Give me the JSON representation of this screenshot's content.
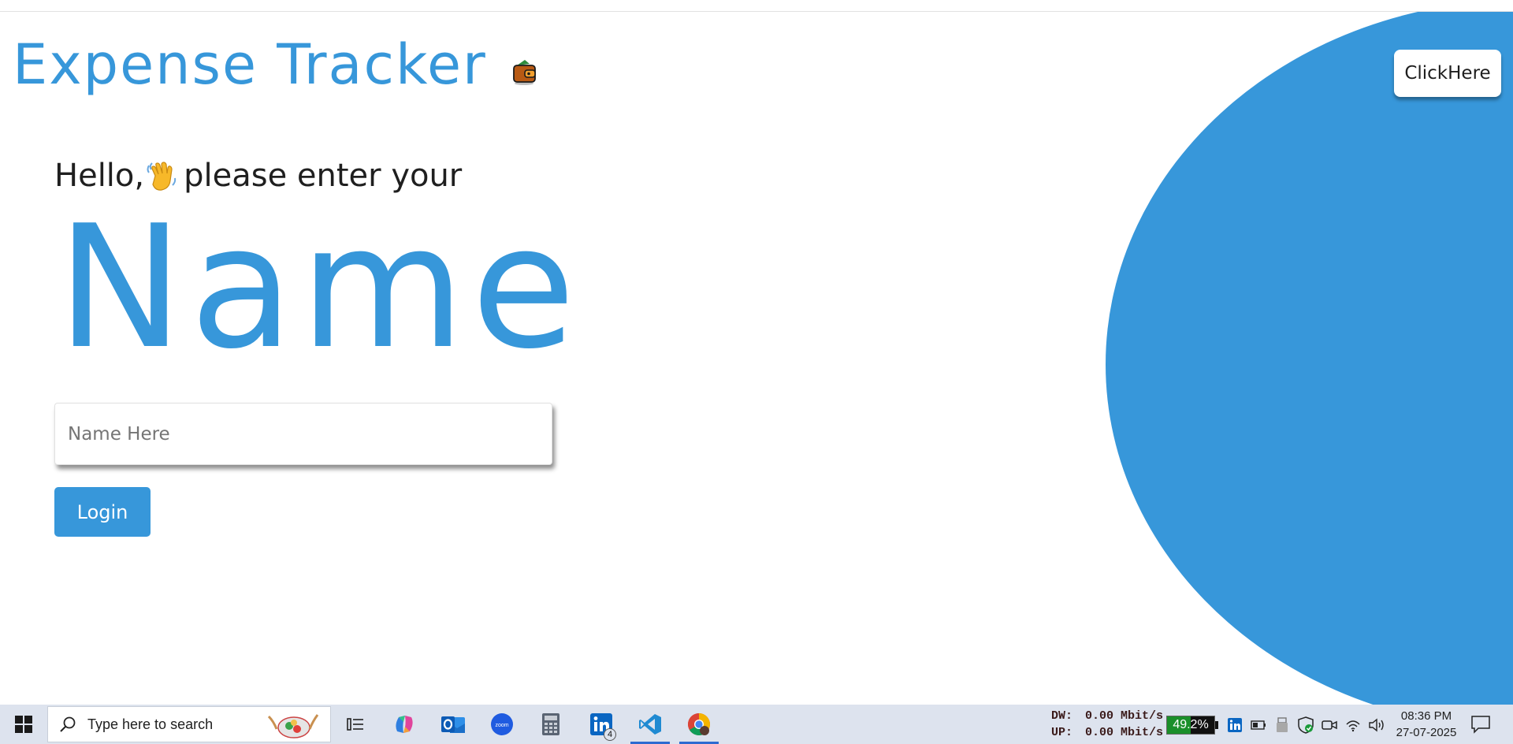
{
  "app": {
    "title": "Expense Tracker",
    "title_icon": "wallet-icon",
    "header_button_label": "ClickHere"
  },
  "colors": {
    "accent": "#3797da",
    "text_dark": "#1f1f1f",
    "taskbar_bg": "#dde3ee"
  },
  "login": {
    "greeting_prefix": "Hello,",
    "greeting_icon": "waving-hand-icon",
    "greeting_suffix": " please enter your",
    "big_word": "Name",
    "name_input": {
      "placeholder": "Name Here",
      "value": ""
    },
    "login_button_label": "Login"
  },
  "taskbar": {
    "search_placeholder": "Type here to search",
    "apps": [
      {
        "name": "task-view-icon",
        "active": false
      },
      {
        "name": "copilot-icon",
        "active": false
      },
      {
        "name": "outlook-icon",
        "active": false
      },
      {
        "name": "zoom-icon",
        "active": false,
        "label": "zoom"
      },
      {
        "name": "calculator-icon",
        "active": false
      },
      {
        "name": "linkedin-icon",
        "active": false,
        "badge": "4"
      },
      {
        "name": "vscode-icon",
        "active": true
      },
      {
        "name": "chrome-icon",
        "active": true
      }
    ],
    "network": {
      "down_label": "DW:",
      "down_value": "0.00 Mbit/s",
      "up_label": "UP:",
      "up_value": "0.00 Mbit/s"
    },
    "battery_percent": "49.2%",
    "battery_level": 0.492,
    "clock": {
      "time": "08:36 PM",
      "date": "27-07-2025"
    }
  }
}
